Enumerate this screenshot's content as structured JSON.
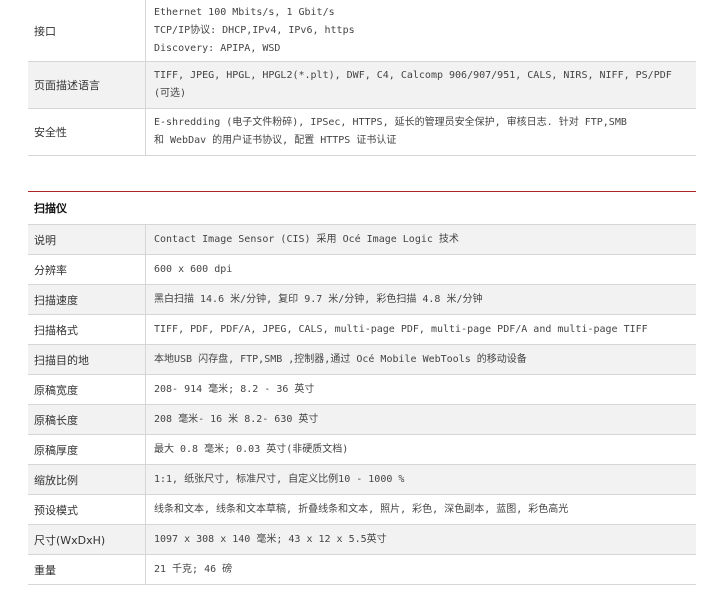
{
  "top_rows": [
    {
      "key": "接口",
      "lines": [
        "Ethernet 100 Mbits/s, 1 Gbit/s",
        "TCP/IP协议: DHCP,IPv4, IPv6, https",
        "Discovery: APIPA, WSD"
      ]
    },
    {
      "key": "页面描述语言",
      "lines": [
        "TIFF, JPEG, HPGL, HPGL2(*.plt), DWF, C4, Calcomp 906/907/951, CALS, NIRS, NIFF, PS/PDF",
        "(可选)"
      ]
    },
    {
      "key": "安全性",
      "lines": [
        "E-shredding (电子文件粉碎), IPSec, HTTPS, 延长的管理员安全保护, 审核日志. 针对 FTP,SMB",
        "和 WebDav 的用户证书协议, 配置 HTTPS 证书认证"
      ]
    }
  ],
  "section_title": "扫描仪",
  "scanner_rows": [
    {
      "key": "说明",
      "value": "Contact Image Sensor (CIS) 采用 Océ Image Logic 技术"
    },
    {
      "key": "分辨率",
      "value": "600 x 600 dpi"
    },
    {
      "key": "扫描速度",
      "value": "黑白扫描 14.6 米/分钟, 复印 9.7 米/分钟, 彩色扫描 4.8 米/分钟"
    },
    {
      "key": "扫描格式",
      "value": "TIFF, PDF, PDF/A, JPEG, CALS, multi-page PDF, multi-page PDF/A and multi-page TIFF"
    },
    {
      "key": "扫描目的地",
      "value": "本地USB 闪存盘, FTP,SMB ,控制器,通过 Océ Mobile WebTools 的移动设备"
    },
    {
      "key": "原稿宽度",
      "value": "208- 914 毫米; 8.2 - 36 英寸"
    },
    {
      "key": "原稿长度",
      "value": "208 毫米- 16 米 8.2- 630 英寸"
    },
    {
      "key": "原稿厚度",
      "value": "最大 0.8 毫米; 0.03 英寸(非硬质文档)"
    },
    {
      "key": "缩放比例",
      "value": "1:1, 纸张尺寸, 标准尺寸, 自定义比例10 - 1000 %"
    },
    {
      "key": "预设模式",
      "value": "线条和文本, 线条和文本草稿, 折叠线条和文本, 照片, 彩色, 深色副本, 蓝图, 彩色高光"
    },
    {
      "key": "尺寸(WxDxH)",
      "value": "1097 x 308 x 140 毫米; 43 x 12 x 5.5英寸"
    },
    {
      "key": "重量",
      "value": "21 千克; 46 磅"
    }
  ]
}
